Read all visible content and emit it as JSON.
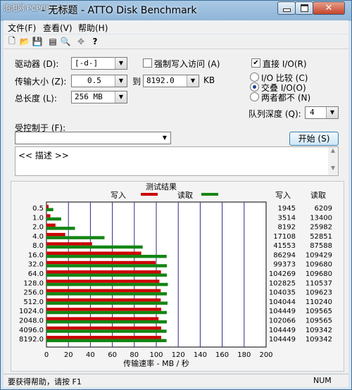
{
  "window": {
    "watermark": "泡泡网 PCPOP.COM",
    "title": "- 无标题 - ATTO Disk Benchmark",
    "min_icon": "minimize-icon",
    "max_icon": "maximize-icon",
    "close_icon": "close-icon"
  },
  "menu": [
    "文件(F)",
    "查看(V)",
    "帮助(H)"
  ],
  "toolbar_icons": [
    "new-file-icon",
    "open-folder-icon",
    "save-icon",
    "print-preview-icon",
    "zoom-icon",
    "move-icon",
    "help-icon"
  ],
  "form": {
    "drive_label": "驱动器 (D):",
    "drive_value": "[-d-]",
    "force_write_label": "强制写入访问 (A)",
    "force_write_checked": false,
    "direct_io_label": "直接 I/O(R)",
    "direct_io_checked": true,
    "transfer_label": "传输大小 (Z):",
    "transfer_from": "0.5",
    "to_label": "到",
    "transfer_to": "8192.0",
    "kb_label": "KB",
    "total_label": "总长度 (L):",
    "total_value": "256 MB",
    "io_compare_label": "I/O 比较 (C)",
    "overlap_label": "交叠 I/O(O)",
    "neither_label": "两者都不 (N)",
    "selected_mode": "overlap",
    "queue_label": "队列深度 (Q):",
    "queue_value": "4",
    "controlled_label": "受控制于 (F):",
    "controlled_value": "",
    "start_button": "开始 (S)",
    "description": "<< 描述 >>"
  },
  "chart_data": {
    "type": "bar",
    "title": "测试结果",
    "legend": {
      "write": "写入",
      "read": "读取"
    },
    "write_color": "#cc0000",
    "read_color": "#138613",
    "categories": [
      "0.5",
      "1.0",
      "2.0",
      "4.0",
      "8.0",
      "16.0",
      "32.0",
      "64.0",
      "128.0",
      "256.0",
      "512.0",
      "1024.0",
      "2048.0",
      "4096.0",
      "8192.0"
    ],
    "series": [
      {
        "name": "写入",
        "values": [
          1945,
          3514,
          8192,
          17108,
          41553,
          86294,
          99373,
          104269,
          102825,
          104035,
          104044,
          104449,
          102066,
          104449,
          104449
        ]
      },
      {
        "name": "读取",
        "values": [
          6209,
          13400,
          25982,
          52851,
          87588,
          109429,
          109680,
          109680,
          110537,
          109623,
          110240,
          109565,
          109565,
          109342,
          109342
        ]
      }
    ],
    "write_header": "写入",
    "read_header": "读取",
    "xlabel": "传输速率 - MB / 秒",
    "xticks": [
      "0",
      "20",
      "40",
      "60",
      "80",
      "100",
      "120",
      "140",
      "160",
      "180",
      "200"
    ],
    "xlim": [
      0,
      200
    ]
  },
  "status": {
    "help": "要获得帮助，请按 F1",
    "num": "NUM"
  }
}
